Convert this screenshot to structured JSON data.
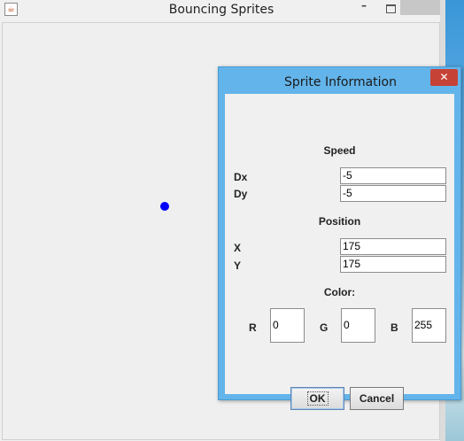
{
  "main_window": {
    "title": "Bouncing Sprites",
    "app_icon": "java-cup-icon",
    "icon_glyph": "☕",
    "minimize_glyph": "–",
    "close_glyph": "✕"
  },
  "sprite": {
    "color": "#0000ff"
  },
  "dialog": {
    "title": "Sprite Information",
    "close_glyph": "✕",
    "speed": {
      "heading": "Speed",
      "dx_label": "Dx",
      "dx_value": "-5",
      "dy_label": "Dy",
      "dy_value": "-5"
    },
    "position": {
      "heading": "Position",
      "x_label": "X",
      "x_value": "175",
      "y_label": "Y",
      "y_value": "175"
    },
    "color": {
      "heading": "Color:",
      "r_label": "R",
      "r_value": "0",
      "g_label": "G",
      "g_value": "0",
      "b_label": "B",
      "b_value": "255"
    },
    "ok_label": "OK",
    "cancel_label": "Cancel"
  },
  "colors": {
    "dialog_frame": "#63b4ea",
    "close_button": "#c74236",
    "window_bg": "#f0f0f0"
  }
}
